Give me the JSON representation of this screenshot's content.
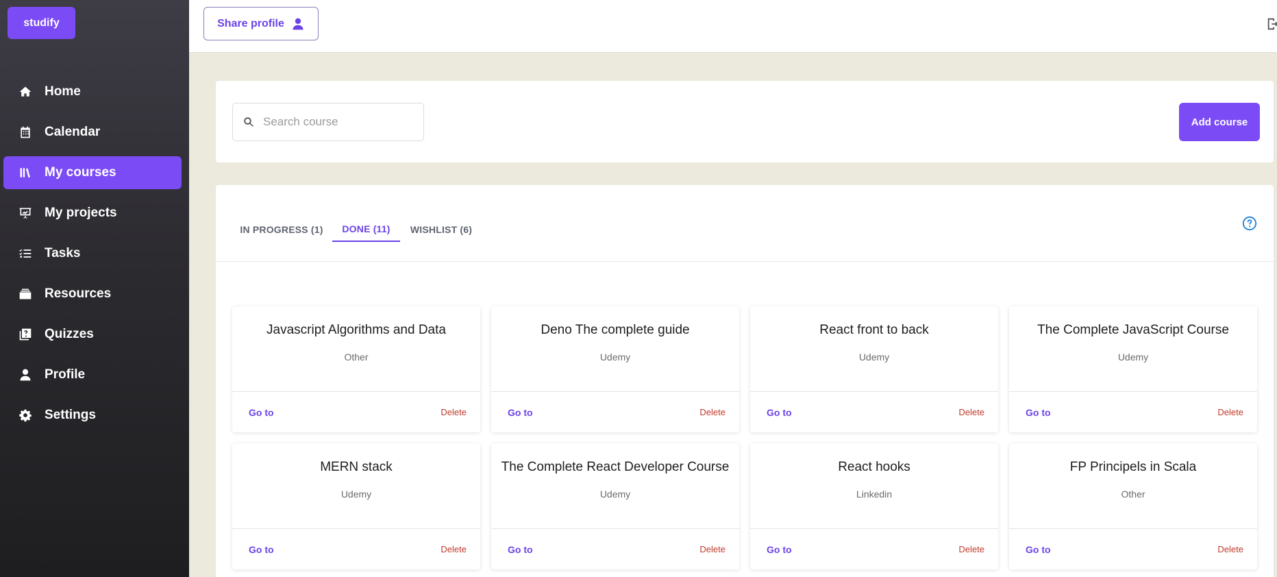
{
  "app": {
    "logo": "studify"
  },
  "sidebar": {
    "items": [
      {
        "label": "Home",
        "icon": "home-icon",
        "active": false
      },
      {
        "label": "Calendar",
        "icon": "calendar-icon",
        "active": false
      },
      {
        "label": "My courses",
        "icon": "books-icon",
        "active": true
      },
      {
        "label": "My projects",
        "icon": "presentation-icon",
        "active": false
      },
      {
        "label": "Tasks",
        "icon": "checklist-icon",
        "active": false
      },
      {
        "label": "Resources",
        "icon": "layers-icon",
        "active": false
      },
      {
        "label": "Quizzes",
        "icon": "quiz-icon",
        "active": false
      },
      {
        "label": "Profile",
        "icon": "user-icon",
        "active": false
      },
      {
        "label": "Settings",
        "icon": "gear-icon",
        "active": false
      }
    ]
  },
  "topbar": {
    "share_label": "Share profile"
  },
  "search": {
    "placeholder": "Search course",
    "value": ""
  },
  "actions": {
    "add_label": "Add course"
  },
  "tabs": [
    {
      "label": "IN PROGRESS (1)",
      "active": false
    },
    {
      "label": "DONE (11)",
      "active": true
    },
    {
      "label": "WISHLIST (6)",
      "active": false
    }
  ],
  "courses": [
    {
      "title": "Javascript Algorithms and Data",
      "platform": "Other"
    },
    {
      "title": "Deno The complete guide",
      "platform": "Udemy"
    },
    {
      "title": "React front to back",
      "platform": "Udemy"
    },
    {
      "title": "The Complete JavaScript Course",
      "platform": "Udemy"
    },
    {
      "title": "MERN stack",
      "platform": "Udemy"
    },
    {
      "title": "The Complete React Developer Course",
      "platform": "Udemy"
    },
    {
      "title": "React hooks",
      "platform": "Linkedin"
    },
    {
      "title": "FP Principels in Scala",
      "platform": "Other"
    }
  ],
  "card_actions": {
    "goto_label": "Go to",
    "delete_label": "Delete"
  },
  "colors": {
    "accent": "#7b4bf5",
    "delete": "#c0392b",
    "help": "#1e7fd6"
  }
}
